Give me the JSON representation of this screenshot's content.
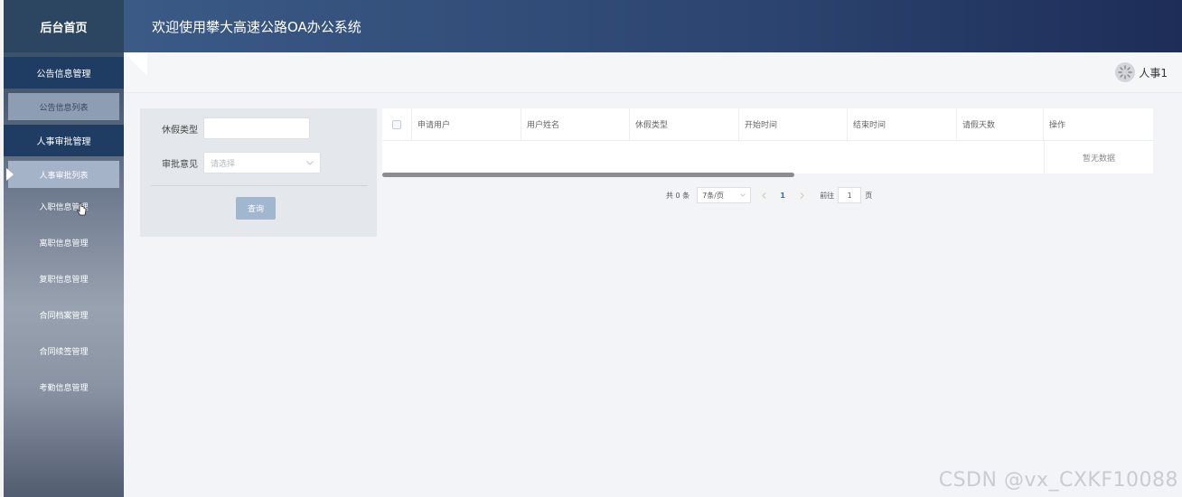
{
  "sidebar": {
    "title": "后台首页",
    "groups": [
      {
        "label": "公告信息管理",
        "items": [
          {
            "label": "公告信息列表"
          }
        ]
      },
      {
        "label": "人事审批管理",
        "items": [
          {
            "label": "人事审批列表"
          }
        ]
      }
    ],
    "items": [
      {
        "label": "入职信息管理"
      },
      {
        "label": "离职信息管理"
      },
      {
        "label": "复职信息管理"
      },
      {
        "label": "合同档案管理"
      },
      {
        "label": "合同续签管理"
      },
      {
        "label": "考勤信息管理"
      }
    ]
  },
  "header": {
    "title": "欢迎使用攀大高速公路OA办公系统"
  },
  "user": {
    "name": "人事1"
  },
  "search": {
    "leave_type_label": "休假类型",
    "leave_type_value": "",
    "approval_label": "审批意见",
    "approval_placeholder": "请选择",
    "query_button": "查询"
  },
  "table": {
    "columns": [
      "申请用户",
      "用户姓名",
      "休假类型",
      "开始时间",
      "结束时间",
      "请假天数",
      "操作"
    ],
    "rows": [],
    "empty_text": "暂无数据"
  },
  "pagination": {
    "total_text": "共 0 条",
    "page_size": "7条/页",
    "current_page": "1",
    "goto_label": "前往",
    "goto_value": "1",
    "page_suffix": "页"
  },
  "watermark": "CSDN @vx_CXKF10088"
}
